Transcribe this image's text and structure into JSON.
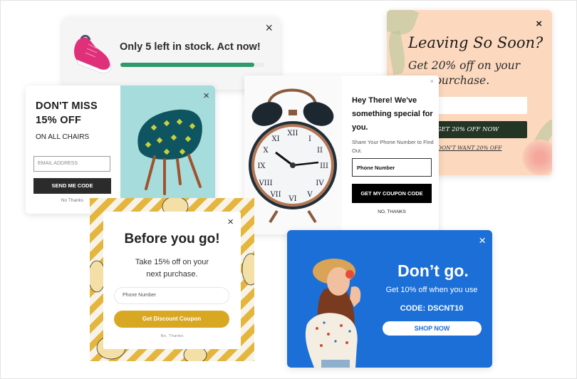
{
  "colors": {
    "stock_bar": "#2e9a6b",
    "leaving_bg": "#fcd9be",
    "leaving_button": "#233524",
    "chairs_image_bg": "#a6dcdc",
    "before_button": "#d9a823",
    "before_pattern": "#e5b63d",
    "dontgo_bg": "#1c6fd6"
  },
  "stock_popup": {
    "image": "pink-sneaker-icon",
    "message": "Only 5 left in stock. Act now!",
    "progress_fraction": 0.93,
    "close_icon": "×"
  },
  "leaving_popup": {
    "title": "Leaving So Soon?",
    "subtitle": "Get 20% off on your first purchase.",
    "email_placeholder": "EMAIL",
    "cta_label": "GET 20% OFF NOW",
    "decline_label": "I DON'T WANT 20% OFF",
    "close_icon": "×"
  },
  "chairs_popup": {
    "title_line1": "DON'T MISS",
    "title_line2": "15% OFF",
    "subtitle": "ON ALL CHAIRS",
    "email_placeholder": "EMAIL ADDRESS",
    "cta_label": "SEND ME CODE",
    "decline_label": "No Thanks",
    "image": "armchair-icon",
    "close_icon": "×"
  },
  "clock_popup": {
    "title": "Hey There! We've something special for you.",
    "subtitle": "Share Your Phone Number to Find Out.",
    "phone_placeholder": "Phone Number",
    "cta_label": "GET MY COUPON CODE",
    "decline_label": "NO, THANKS",
    "image": "alarm-clock-icon",
    "close_icon": "×"
  },
  "before_popup": {
    "title": "Before you go!",
    "subtitle_line1": "Take 15% off on your",
    "subtitle_line2": "next purchase.",
    "phone_placeholder": "Phone Number",
    "cta_label": "Get Discount Coupon",
    "decline_label": "No, Thanks",
    "close_icon": "×"
  },
  "dontgo_popup": {
    "title": "Don’t go.",
    "subtitle": "Get 10% off  when you use",
    "code": "CODE: DSCNT10",
    "cta_label": "SHOP NOW",
    "image": "woman-shouting-icon",
    "close_icon": "×"
  }
}
